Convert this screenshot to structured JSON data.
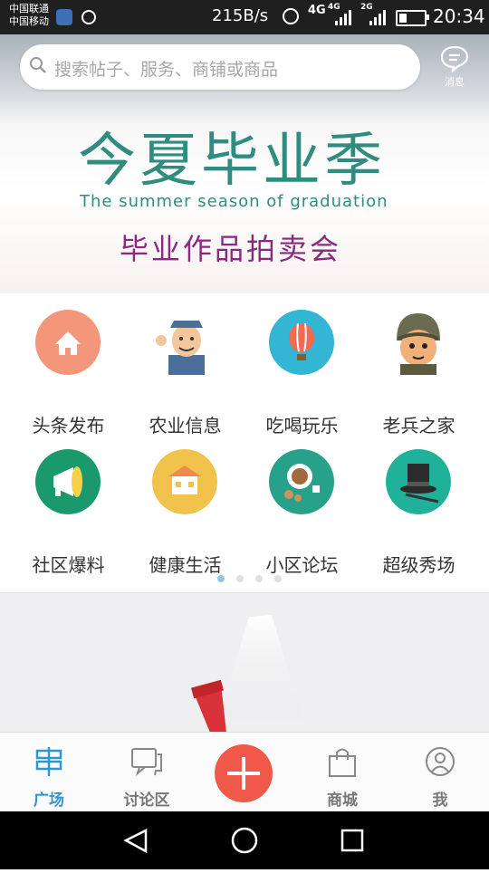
{
  "status_bar": {
    "carrier1": "中国联通",
    "carrier2": "中国移动",
    "speed": "215B/s",
    "net1": "4G",
    "net2": "4G",
    "net3": "2G",
    "time": "20:34"
  },
  "search": {
    "placeholder": "搜索帖子、服务、商铺或商品"
  },
  "messages": {
    "label": "消息"
  },
  "banner": {
    "title": "今夏毕业季",
    "subtitle": "The summer season of graduation",
    "event": "毕业作品拍卖会"
  },
  "categories": [
    {
      "label": "头条发布",
      "icon": "home-icon",
      "color": "#f4967a"
    },
    {
      "label": "农业信息",
      "icon": "farmer-icon",
      "color": "#5a7fa8"
    },
    {
      "label": "吃喝玩乐",
      "icon": "balloon-icon",
      "color": "#33b6d4"
    },
    {
      "label": "老兵之家",
      "icon": "soldier-icon",
      "color": "#6b6b4f"
    },
    {
      "label": "社区爆料",
      "icon": "megaphone-icon",
      "color": "#1a9a6c"
    },
    {
      "label": "健康生活",
      "icon": "hospital-icon",
      "color": "#f2c34c"
    },
    {
      "label": "小区论坛",
      "icon": "coffee-icon",
      "color": "#27a18a"
    },
    {
      "label": "超级秀场",
      "icon": "magic-hat-icon",
      "color": "#1fb19a"
    }
  ],
  "pager": {
    "pages": 4,
    "current": 1
  },
  "tabs": [
    {
      "label": "广场",
      "icon": "square-signpost-icon",
      "active": true
    },
    {
      "label": "讨论区",
      "icon": "chat-icon",
      "active": false
    },
    {
      "label": "",
      "icon": "plus-icon",
      "active": false
    },
    {
      "label": "商城",
      "icon": "shopping-bag-icon",
      "active": false
    },
    {
      "label": "我",
      "icon": "user-icon",
      "active": false
    }
  ],
  "colors": {
    "accent": "#2f95d4",
    "plus": "#f0584a",
    "banner_green": "#2f8c7e",
    "banner_purple": "#8a2a7e"
  }
}
